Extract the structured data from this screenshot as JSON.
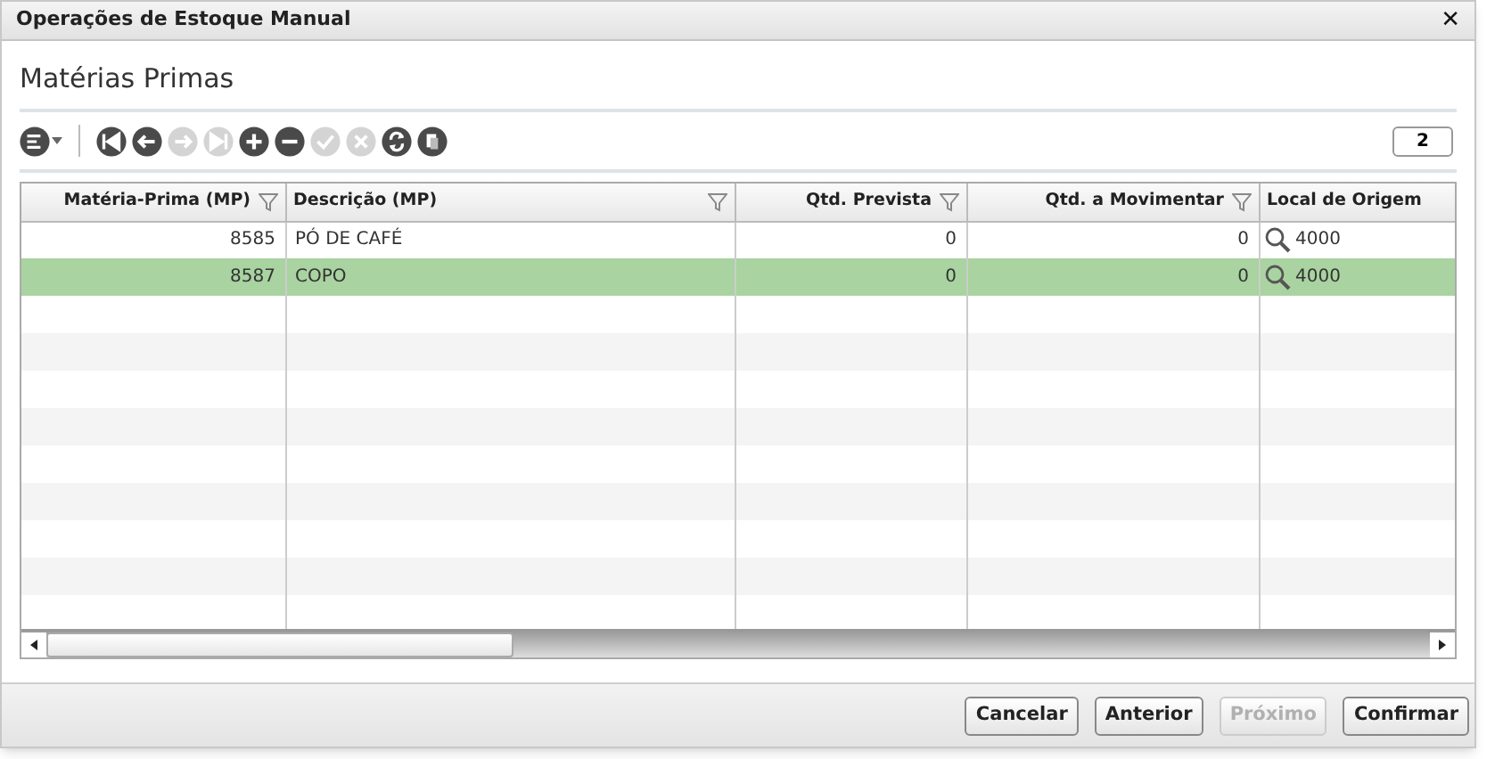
{
  "window": {
    "title": "Operações de Estoque Manual",
    "close": "✕"
  },
  "section_title": "Matérias Primas",
  "toolbar": [
    {
      "kind": "menu",
      "disabled": false
    },
    {
      "kind": "first",
      "disabled": false
    },
    {
      "kind": "prev",
      "disabled": false
    },
    {
      "kind": "next",
      "disabled": true
    },
    {
      "kind": "last",
      "disabled": true
    },
    {
      "kind": "add",
      "disabled": false
    },
    {
      "kind": "remove",
      "disabled": false
    },
    {
      "kind": "confirm",
      "disabled": true
    },
    {
      "kind": "cancel",
      "disabled": true
    },
    {
      "kind": "refresh",
      "disabled": false
    },
    {
      "kind": "copy",
      "disabled": false
    }
  ],
  "record_count": "2",
  "table": {
    "columns": [
      {
        "label": "Matéria-Prima (MP)",
        "filter": true
      },
      {
        "label": "Descrição (MP)",
        "filter": true
      },
      {
        "label": "Qtd. Prevista",
        "filter": true
      },
      {
        "label": "Qtd. a Movimentar",
        "filter": true
      },
      {
        "label": "Local de Origem",
        "filter": false
      }
    ],
    "rows": [
      {
        "selected": false,
        "cells": [
          "8585",
          "PÓ DE CAFÉ",
          "0",
          "0",
          "4000"
        ]
      },
      {
        "selected": true,
        "cells": [
          "8587",
          "COPO",
          "0",
          "0",
          "4000"
        ]
      }
    ]
  },
  "buttons": [
    {
      "label": "Cancelar",
      "disabled": false
    },
    {
      "label": "Anterior",
      "disabled": false
    },
    {
      "label": "Próximo",
      "disabled": true
    },
    {
      "label": "Confirmar",
      "disabled": false
    }
  ]
}
